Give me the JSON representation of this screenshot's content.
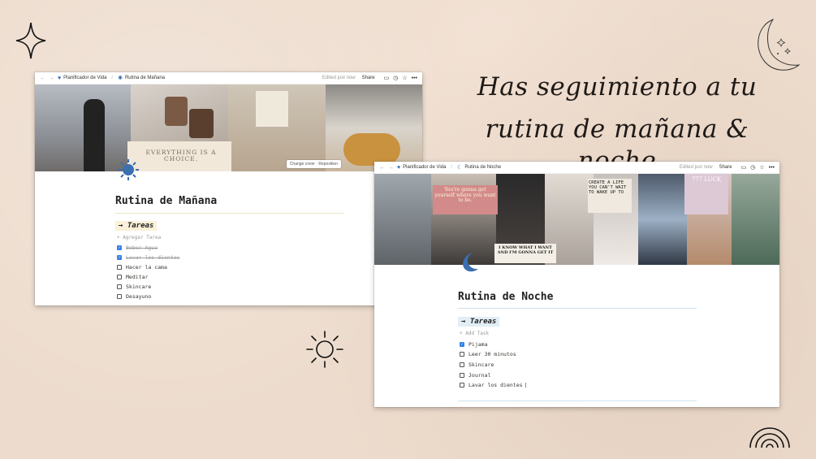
{
  "headline": {
    "line1": "Has seguimiento a tu",
    "line2": "rutina de mañana & noche"
  },
  "decorations": [
    "sparkle-icon",
    "moon-icon",
    "sun-icon",
    "rainbow-icon"
  ],
  "morning": {
    "breadcrumb_parent": "Planificador de Vida",
    "breadcrumb_page": "Rutina de Mañana",
    "edited": "Edited just now",
    "share": "Share",
    "cover_text": "EVERYTHING IS A CHOICE.",
    "cover_actions": "Change cover · Reposition",
    "title": "Rutina de Mañana",
    "section": "→ Tareas",
    "add_task": "+ Agregar Tarea",
    "tasks": [
      {
        "label": "Beber Agua",
        "checked": true
      },
      {
        "label": "Lavar los dientes",
        "checked": true
      },
      {
        "label": "Hacer la cama",
        "checked": false
      },
      {
        "label": "Meditar",
        "checked": false
      },
      {
        "label": "Skincare",
        "checked": false
      },
      {
        "label": "Desayuno",
        "checked": false
      }
    ]
  },
  "night": {
    "breadcrumb_parent": "Planificador de Vida",
    "breadcrumb_page": "Rutina de Noche",
    "edited": "Edited just now",
    "share": "Share",
    "collage_quote1": "You're gonna get yourself where you want to be.",
    "collage_quote2": "I KNOW WHAT I WANT AND I'M GONNA GET IT",
    "collage_quote3": "CREATE A LIFE YOU CAN'T WAIT TO WAKE UP TO",
    "collage_luck": "777 LUCK",
    "title": "Rutina de Noche",
    "section": "→ Tareas",
    "add_task": "+ Add Task",
    "tasks": [
      {
        "label": "Pijama",
        "checked": true
      },
      {
        "label": "Leer 30 minutos",
        "checked": false
      },
      {
        "label": "Skincare",
        "checked": false
      },
      {
        "label": "Journal",
        "checked": false
      },
      {
        "label": "Lavar los dientes",
        "checked": false
      }
    ]
  }
}
